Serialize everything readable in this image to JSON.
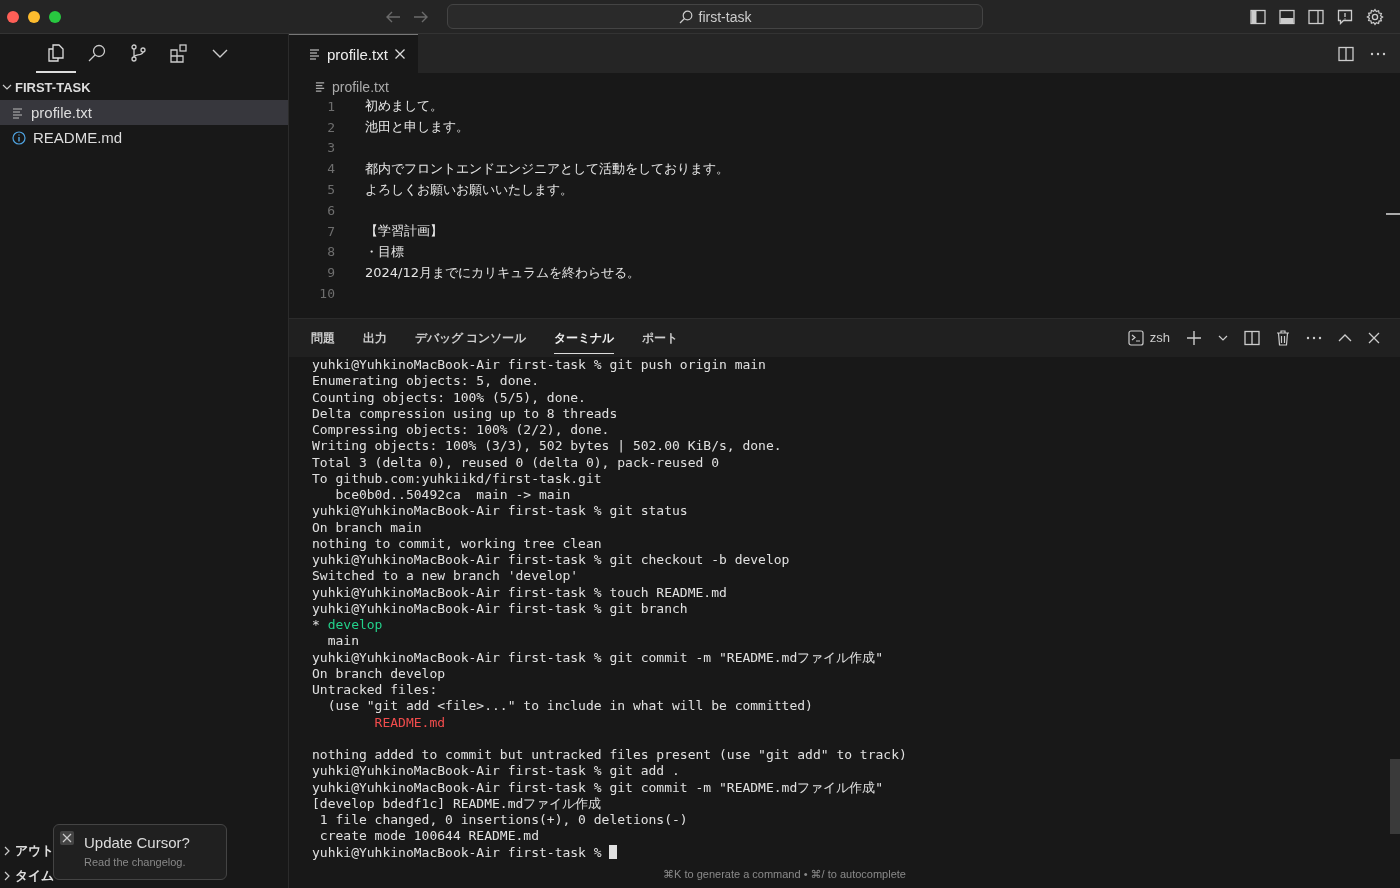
{
  "window": {
    "title": "first-task"
  },
  "sidebar": {
    "views": [
      {
        "selected": true
      },
      {
        "selected": false
      },
      {
        "selected": false
      },
      {
        "selected": false
      },
      {
        "selected": false
      }
    ],
    "folder": {
      "name": "FIRST-TASK",
      "expanded": true
    },
    "files": [
      {
        "name": "profile.txt",
        "selected": true
      },
      {
        "name": "README.md",
        "selected": false
      }
    ],
    "sections": [
      {
        "title": "アウト",
        "expanded": false
      },
      {
        "title": "タイム",
        "expanded": false
      }
    ]
  },
  "editor": {
    "tabs": [
      {
        "label": "profile.txt",
        "selected": true
      }
    ],
    "breadcrumb": "profile.txt",
    "lines": [
      {
        "number": "1",
        "text": "初めまして。"
      },
      {
        "number": "2",
        "text": "池田と申します。"
      },
      {
        "number": "3"
      },
      {
        "number": "4",
        "text": "都内でフロントエンドエンジニアとして活動をしております。"
      },
      {
        "number": "5",
        "text": "よろしくお願いお願いいたします。"
      },
      {
        "number": "6"
      },
      {
        "number": "7",
        "text": "【学習計画】"
      },
      {
        "number": "8",
        "text": "・目標"
      },
      {
        "number": "9",
        "text": "2024/12月までにカリキュラムを終わらせる。"
      },
      {
        "number": "10"
      }
    ]
  },
  "panel": {
    "tabs": [
      {
        "label": "問題",
        "selected": false
      },
      {
        "label": "出力",
        "selected": false
      },
      {
        "label": "デバッグ コンソール",
        "selected": false
      },
      {
        "label": "ターミナル",
        "selected": true
      },
      {
        "label": "ポート",
        "selected": false
      }
    ],
    "shell": "zsh",
    "terminal": [
      {
        "kind": "plain",
        "text": "yuhki@YuhkinoMacBook-Air first-task % git push origin main"
      },
      {
        "kind": "plain",
        "text": "Enumerating objects: 5, done."
      },
      {
        "kind": "plain",
        "text": "Counting objects: 100% (5/5), done."
      },
      {
        "kind": "plain",
        "text": "Delta compression using up to 8 threads"
      },
      {
        "kind": "plain",
        "text": "Compressing objects: 100% (2/2), done."
      },
      {
        "kind": "plain",
        "text": "Writing objects: 100% (3/3), 502 bytes | 502.00 KiB/s, done."
      },
      {
        "kind": "plain",
        "text": "Total 3 (delta 0), reused 0 (delta 0), pack-reused 0"
      },
      {
        "kind": "plain",
        "text": "To github.com:yuhkiikd/first-task.git"
      },
      {
        "kind": "plain",
        "text": "   bce0b0d..50492ca  main -> main"
      },
      {
        "kind": "plain",
        "text": "yuhki@YuhkinoMacBook-Air first-task % git status"
      },
      {
        "kind": "plain",
        "text": "On branch main"
      },
      {
        "kind": "plain",
        "text": "nothing to commit, working tree clean"
      },
      {
        "kind": "plain",
        "text": "yuhki@YuhkinoMacBook-Air first-task % git checkout -b develop"
      },
      {
        "kind": "plain",
        "text": "Switched to a new branch 'develop'"
      },
      {
        "kind": "plain",
        "text": "yuhki@YuhkinoMacBook-Air first-task % touch README.md"
      },
      {
        "kind": "plain",
        "text": "yuhki@YuhkinoMacBook-Air first-task % git branch"
      },
      {
        "kind": "current-branch",
        "marker": "*",
        "text": "develop"
      },
      {
        "kind": "plain",
        "text": "  main"
      },
      {
        "kind": "plain",
        "text": "yuhki@YuhkinoMacBook-Air first-task % git commit -m \"README.mdファイル作成\""
      },
      {
        "kind": "plain",
        "text": "On branch develop"
      },
      {
        "kind": "plain",
        "text": "Untracked files:"
      },
      {
        "kind": "plain",
        "text": "  (use \"git add <file>...\" to include in what will be committed)"
      },
      {
        "kind": "untracked",
        "text": "        README.md"
      },
      {
        "kind": "blank"
      },
      {
        "kind": "plain",
        "text": "nothing added to commit but untracked files present (use \"git add\" to track)"
      },
      {
        "kind": "plain",
        "text": "yuhki@YuhkinoMacBook-Air first-task % git add ."
      },
      {
        "kind": "plain",
        "text": "yuhki@YuhkinoMacBook-Air first-task % git commit -m \"README.mdファイル作成\""
      },
      {
        "kind": "plain",
        "text": "[develop bdedf1c] README.mdファイル作成"
      },
      {
        "kind": "plain",
        "text": " 1 file changed, 0 insertions(+), 0 deletions(-)"
      },
      {
        "kind": "plain",
        "text": " create mode 100644 README.md"
      },
      {
        "kind": "prompt",
        "text": "yuhki@YuhkinoMacBook-Air first-task % "
      }
    ],
    "hint": "⌘K to generate a command • ⌘/ to autocomplete"
  },
  "notification": {
    "title": "Update Cursor?",
    "message": "Read the changelog."
  }
}
